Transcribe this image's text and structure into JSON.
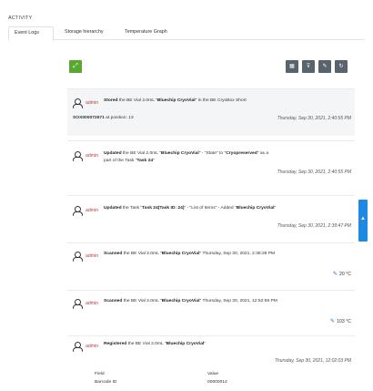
{
  "section_title": "ACTIVITY",
  "tabs": [
    {
      "label": "Event Logs"
    },
    {
      "label": "Storage hierarchy"
    },
    {
      "label": "Temperature Graph"
    }
  ],
  "toolbar": {
    "left_button_icon": "expand-icon",
    "right_icons": [
      "calendar-icon",
      "filter-icon",
      "edit-icon",
      "refresh-icon"
    ]
  },
  "events": [
    {
      "user": "admin",
      "message_prefix": "Stored",
      "message_middle1": " the BE Vial 2.0mL \"",
      "bold1": "Bluechip CryoVial",
      "message_middle2": "\" in the BE CryoBox Short",
      "line2_bold": "SOX000072671",
      "line2_rest": " at position: 13",
      "timestamp": "Thursday, Sep 30, 2021, 2:40:55 PM"
    },
    {
      "user": "admin",
      "message_prefix": "Updated",
      "message_middle1": " the BE Vial 2.0mL \"",
      "bold1": "Bluechip CryoVial",
      "message_middle2": "\" - \"State\" to \"",
      "bold2": "Cryopreserved",
      "message_end": "\" as a",
      "line2_rest": "part of the Task \"",
      "line2_bold": "Task 24",
      "line2_end": "\"",
      "timestamp": "Thursday, Sep 30, 2021, 2:40:55 PM"
    },
    {
      "user": "admin",
      "message_prefix": "Updated",
      "message_middle1": " the Task \"",
      "bold1": "Task 24(Task ID: 24)",
      "message_middle2": "\" - \"List of Items\" - Added \"",
      "bold2": "Bluechip CryoVial",
      "message_end": "\"",
      "timestamp": "Thursday, Sep 30, 2021, 2:39:47 PM"
    },
    {
      "user": "admin",
      "message_prefix": "Scanned",
      "message_middle1": " the BE Vial 2.0mL \"",
      "bold1": "Bluechip CryoVial",
      "message_middle2": "\" Thursday, Sep 30, 2021, 2:38:28 PM",
      "temperature": "20 °C"
    },
    {
      "user": "admin",
      "message_prefix": "Scanned",
      "message_middle1": " the BE Vial 2.0mL \"",
      "bold1": "Bluechip CryoVial",
      "message_middle2": "\" Thursday, Sep 30, 2021, 12:52:59 PM",
      "temperature": "103 °C"
    },
    {
      "user": "admin",
      "message_prefix": "Registered",
      "message_middle1": " the BE Vial 2.0mL \"",
      "bold1": "Bluechip CryoVial",
      "message_middle2": "\"",
      "timestamp": "Thursday, Sep 30, 2021, 12:02:03 PM",
      "field_header": "Field",
      "value_header": "Value",
      "field_name": "Barcode ID",
      "field_value": "00000014"
    }
  ],
  "side_tab_icon": "chevron-up-icon"
}
